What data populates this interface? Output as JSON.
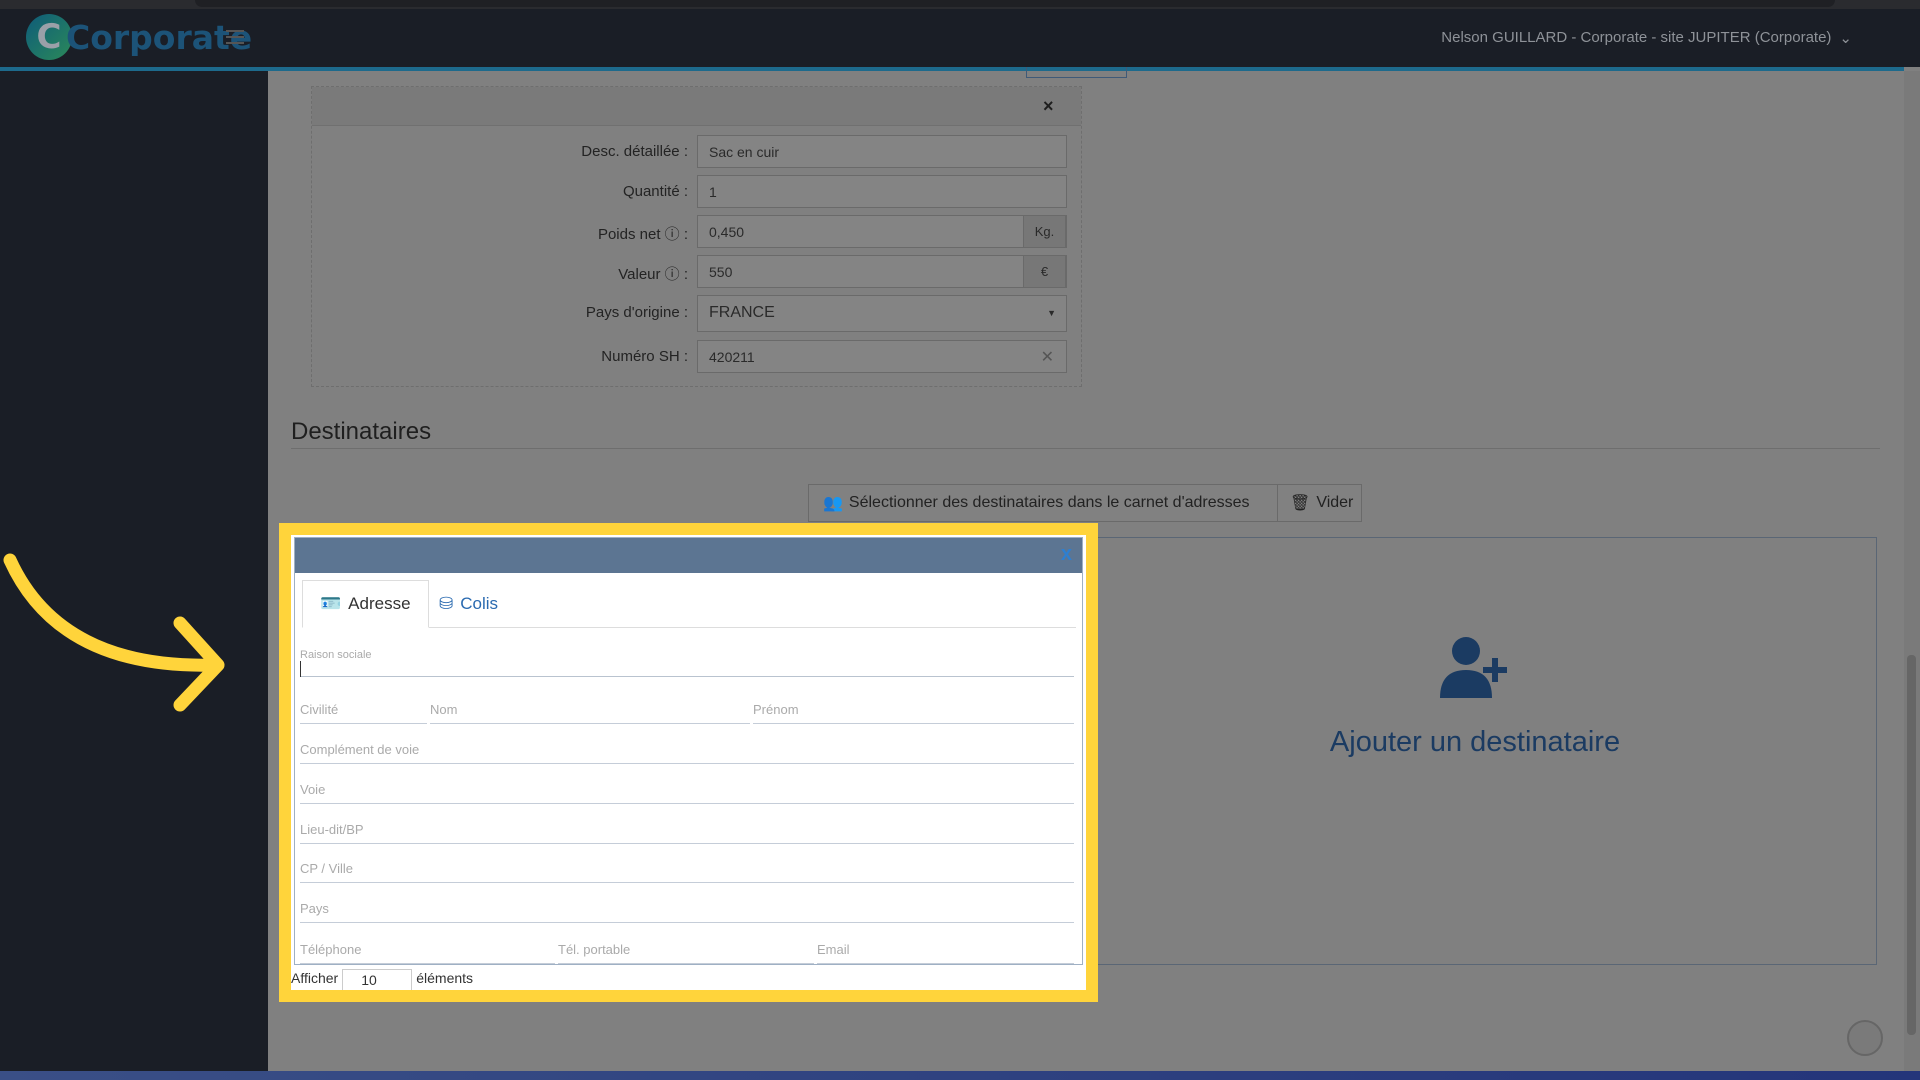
{
  "app": {
    "logo_text": "Corporate",
    "user_menu": "Nelson GUILLARD - Corporate - site JUPITER (Corporate)"
  },
  "item_form": {
    "close": "×",
    "fields": [
      {
        "label": "Desc. détaillée :",
        "value": "Sac en cuir"
      },
      {
        "label": "Quantité :",
        "value": "1"
      },
      {
        "label": "Poids net ⓘ :",
        "value": "0,450",
        "unit": "Kg."
      },
      {
        "label": "Valeur ⓘ :",
        "value": "550",
        "unit": "€"
      },
      {
        "label": "Pays d'origine :",
        "value": "FRANCE"
      },
      {
        "label": "Numéro SH :",
        "value": "420211"
      }
    ]
  },
  "destinataires": {
    "title": "Destinataires",
    "select_button": "Sélectionner des destinataires dans le carnet d'adresses",
    "clear_button": "Vider",
    "add_label": "Ajouter un destinataire"
  },
  "modal": {
    "close": "x",
    "tabs": [
      {
        "label": "Adresse",
        "active": true
      },
      {
        "label": "Colis",
        "active": false
      }
    ],
    "fields": {
      "raison_sociale": "Raison sociale",
      "civilite": "Civilité",
      "nom": "Nom",
      "prenom": "Prénom",
      "complement": "Complément de voie",
      "voie": "Voie",
      "lieu_dit": "Lieu-dit/BP",
      "cp_ville": "CP / Ville",
      "pays": "Pays",
      "telephone": "Téléphone",
      "tel_portable": "Tél. portable",
      "email": "Email"
    },
    "below": {
      "prefix": "Afficher",
      "value": "10",
      "suffix": "éléments"
    }
  },
  "colors": {
    "highlight": "#ffd43b",
    "modal_header": "#5c7592",
    "accent": "#1b3b62"
  }
}
